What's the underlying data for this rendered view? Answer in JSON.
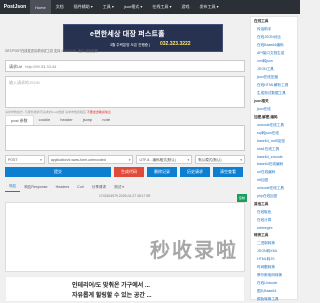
{
  "nav": {
    "logo": "PostJson",
    "items": [
      "Home",
      "文档",
      "插件辅助 ▾",
      "工具 ▾",
      "json格式 ▾",
      "在线工具 ▾",
      "游戏",
      "发布工具 ▾"
    ]
  },
  "banner": {
    "headline": "e편한세상 대장 퍼스트홀",
    "subline": "3월 주력분양 오픈 진행중 |",
    "phone": "032.323.3222"
  },
  "tip": "GET/POST在线发送请求测试工具 支持 JSON/XML 格式 返回结果",
  "url_field": {
    "label": "请求Url",
    "value": "http://99.33.33.44"
  },
  "params_field": {
    "placeholder": "输入请求的JSON"
  },
  "sub_tip": {
    "text": "请求参数格式: 与服务端通讯请求的body数据 请求参数和相应",
    "warning": "不要发送敏感信息"
  },
  "request_tabs": [
    "post 参数",
    "cookie",
    "header",
    "jsonp",
    "note"
  ],
  "selects": {
    "method": "POST",
    "content_type": "application/x-www-form-urlencoded",
    "charset": "UTF-8 - 编码格式(默认)",
    "mode": "默认模式(默认)"
  },
  "actions": {
    "send": "提交",
    "generate": "生成代码",
    "save": "删除记录",
    "history": "历史请求",
    "clear": "清空查看"
  },
  "response_tabs": [
    "响应",
    "响应Response",
    "Headers",
    "Curl",
    "分享请求",
    "测试 ▾"
  ],
  "timestamp": "1743154979 2025-04-27 08:17:59",
  "copy_label": "复制",
  "ad": {
    "line1": "인테리어/도 맞춰온 가구에서 ...",
    "line2": "자유롭게 힐링할 수 있는 공간 ..."
  },
  "watermark": "秒收录啦",
  "sidebar": {
    "groups": [
      {
        "title": "在线工具",
        "items": [
          "传话助手",
          "在线JSON对比",
          "在线Base64编码",
          "API接口文档生成",
          "xml转json",
          "JSON工具",
          "json在线压缩",
          "在线HTML解析工具",
          "生成测试数据工具"
        ]
      },
      {
        "title": "json相关",
        "items": [
          "json在线"
        ]
      },
      {
        "title": "加密,解密,编码",
        "items": [
          "unicode在线工具",
          "sql转json在线",
          "base64_md5加密",
          "sha1在线工具",
          "base64_encode",
          "base64在线编码",
          "url在线编码",
          "htt加密",
          "unicode在线工具",
          "php在线加密"
        ]
      },
      {
        "title": "其他工具",
        "items": [
          "在线取色",
          "在线计算",
          "webregex"
        ]
      },
      {
        "title": "转换工具",
        "items": [
          "二进制转换",
          "JSON转XML",
          "HTML转JS",
          "时间戳转换",
          "摩尔斯电码转换",
          "在线Unicode",
          "图片Base64",
          "颜色转换工具"
        ]
      }
    ]
  }
}
